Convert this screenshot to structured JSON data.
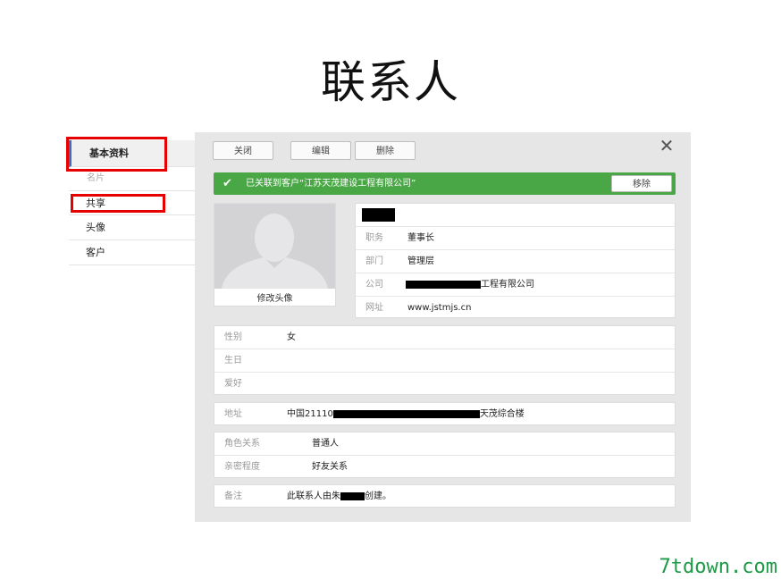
{
  "slide_title": "联系人",
  "sidebar": {
    "items": [
      {
        "label": "基本资料"
      },
      {
        "label": "名片"
      },
      {
        "label": "共享"
      },
      {
        "label": "头像"
      },
      {
        "label": "客户"
      }
    ]
  },
  "toolbar": {
    "close_label": "关闭",
    "edit_label": "编辑",
    "delete_label": "删除"
  },
  "notice": {
    "text": "已关联到客户“江苏天茂建设工程有限公司”",
    "remove_label": "移除",
    "color": "#4aa746"
  },
  "avatar": {
    "edit_label": "修改头像"
  },
  "profile": {
    "title_label": "职务",
    "title_value": "董事长",
    "dept_label": "部门",
    "dept_value": "管理层",
    "company_label": "公司",
    "company_value_visible": "工程有限公司",
    "website_label": "网址",
    "website_value": "www.jstmjs.cn"
  },
  "personal": {
    "gender_label": "性别",
    "gender_value": "女",
    "birthday_label": "生日",
    "hobby_label": "爱好"
  },
  "address": {
    "label": "地址",
    "value_prefix": "中国21110",
    "value_suffix": "天茂综合楼"
  },
  "relation": {
    "role_label": "角色关系",
    "role_value": "普通人",
    "intimacy_label": "亲密程度",
    "intimacy_value": "好友关系"
  },
  "remark": {
    "label": "备注",
    "value_prefix": "此联系人由朱",
    "value_suffix": "创建。"
  },
  "watermark": "7tdown.com"
}
